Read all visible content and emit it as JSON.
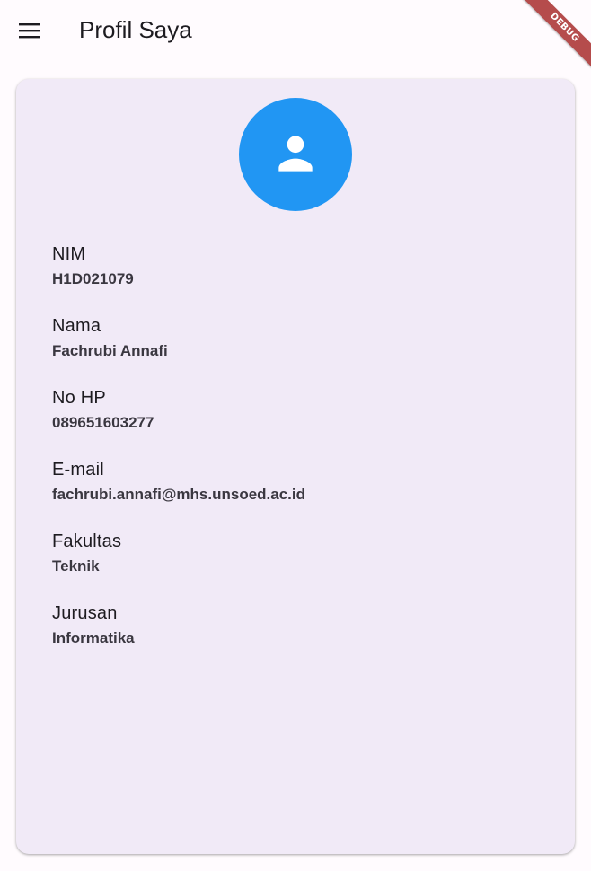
{
  "appbar": {
    "title": "Profil Saya",
    "menu_icon": "menu-icon",
    "debug_label": "DEBUG"
  },
  "profile": {
    "avatar_icon": "person-icon",
    "avatar_color": "#2196f3",
    "fields": [
      {
        "label": "NIM",
        "value": "H1D021079"
      },
      {
        "label": "Nama",
        "value": "Fachrubi Annafi"
      },
      {
        "label": "No HP",
        "value": "089651603277"
      },
      {
        "label": "E-mail",
        "value": "fachrubi.annafi@mhs.unsoed.ac.id"
      },
      {
        "label": "Fakultas",
        "value": "Teknik"
      },
      {
        "label": "Jurusan",
        "value": "Informatika"
      }
    ]
  }
}
